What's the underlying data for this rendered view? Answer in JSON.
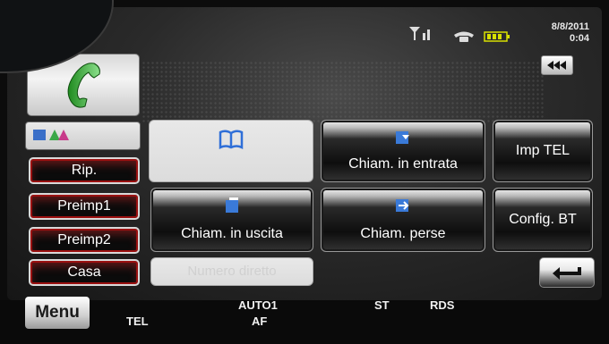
{
  "status": {
    "date": "8/8/2011",
    "time": "0:04"
  },
  "icons": {
    "signal": "signal-icon",
    "phone": "phone-status-icon",
    "battery": "battery-icon",
    "back": "skip-back-icon",
    "return": "return-icon",
    "handset": "handset-icon",
    "phonebook": "phonebook-icon"
  },
  "sidebar": {
    "items": [
      {
        "label": "Rip."
      },
      {
        "label": "Preimp1"
      },
      {
        "label": "Preimp2"
      },
      {
        "label": "Casa"
      }
    ]
  },
  "main": {
    "incoming_label": "Chiam. in entrata",
    "settings_label": "Imp TEL",
    "outgoing_label": "Chiam. in uscita",
    "missed_label": "Chiam. perse",
    "bt_label": "Config. BT",
    "number_direct_label": "Numero diretto"
  },
  "bottom": {
    "menu_label": "Menu",
    "tel": "TEL",
    "auto1": "AUTO1",
    "af": "AF",
    "st": "ST",
    "rds": "RDS"
  },
  "colors": {
    "accent_red": "#9a1010",
    "icon_blue": "#2f6fd8"
  }
}
